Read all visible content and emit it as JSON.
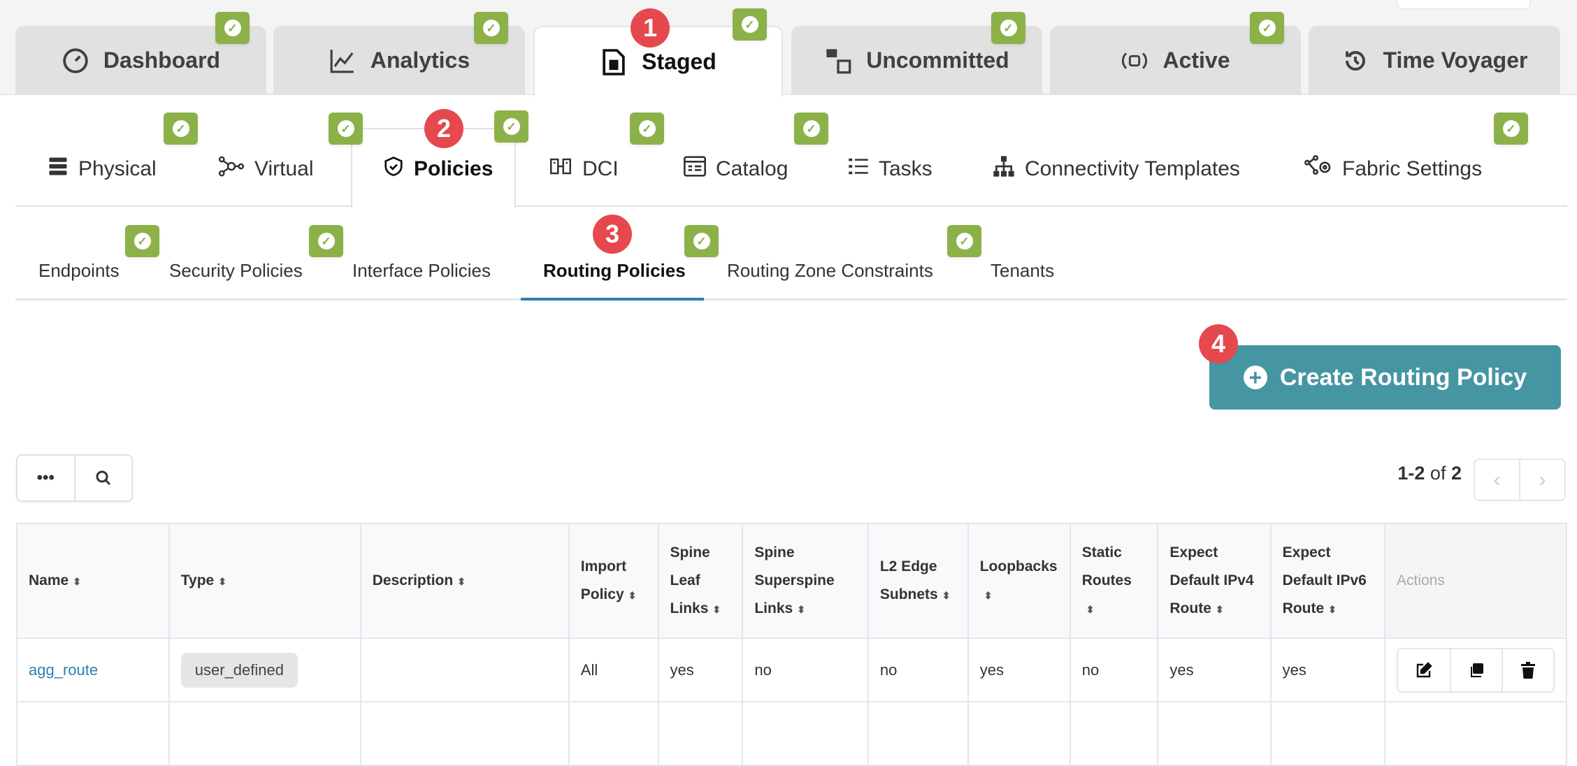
{
  "top_tabs": [
    "Dashboard",
    "Analytics",
    "Staged",
    "Uncommitted",
    "Active",
    "Time Voyager"
  ],
  "second_tabs": [
    "Physical",
    "Virtual",
    "Policies",
    "DCI",
    "Catalog",
    "Tasks",
    "Connectivity Templates",
    "Fabric Settings"
  ],
  "sub_tabs": [
    "Endpoints",
    "Security Policies",
    "Interface Policies",
    "Routing Policies",
    "Routing Zone Constraints",
    "Tenants"
  ],
  "markers": [
    "1",
    "2",
    "3",
    "4"
  ],
  "badge_icon": "✓",
  "create_button": "Create Routing Policy",
  "toolbar": {
    "more": "•••",
    "search": "⌕"
  },
  "pagination": {
    "range": "1-2",
    "of": "of",
    "total": "2",
    "prev": "‹",
    "next": "›"
  },
  "table": {
    "headers": [
      "Name",
      "Type",
      "Description",
      "Import Policy",
      "Spine Leaf Links",
      "Spine Superspine Links",
      "L2 Edge Subnets",
      "Loopbacks",
      "Static Routes",
      "Expect Default IPv4 Route",
      "Expect Default IPv6 Route",
      "Actions"
    ],
    "rows": [
      {
        "name": "agg_route",
        "type": "user_defined",
        "description": "",
        "import_policy": "All",
        "spine_leaf": "yes",
        "spine_superspine": "no",
        "l2_edge": "no",
        "loopbacks": "yes",
        "static_routes": "no",
        "ipv4": "yes",
        "ipv6": "yes"
      }
    ]
  },
  "colors": {
    "accent": "#4695a2",
    "badge": "#8db149",
    "marker": "#e5484d",
    "link": "#2f7fb5"
  }
}
